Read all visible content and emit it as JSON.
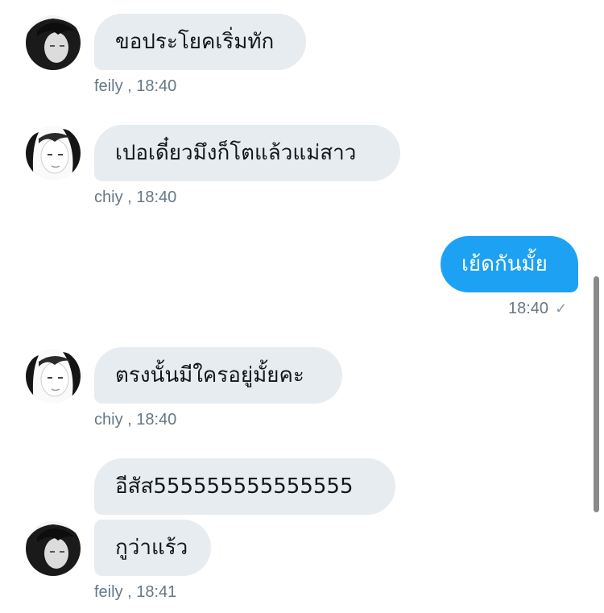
{
  "messages": [
    {
      "id": "m1",
      "direction": "in",
      "sender": "feily",
      "time": "18:40",
      "text": "ขอประโยคเริ่มทัก"
    },
    {
      "id": "m2",
      "direction": "in",
      "sender": "chiy",
      "time": "18:40",
      "text": "เปอเดี๋ยวมึงก็โตแล้วแม่สาว"
    },
    {
      "id": "m3",
      "direction": "out",
      "time": "18:40",
      "text": "เย้ดกันมั้ย",
      "status_icon": "sent-check-icon"
    },
    {
      "id": "m4",
      "direction": "in",
      "sender": "chiy",
      "time": "18:40",
      "text": "ตรงนั้นมีใครอยู่มั้ยคะ"
    },
    {
      "id": "m5",
      "direction": "in",
      "sender": "feily",
      "time": "18:41",
      "text": "อีสัส555555555555555"
    },
    {
      "id": "m6",
      "direction": "in",
      "sender": "feily",
      "time": "18:41",
      "text": "กูว่าแร้ว"
    }
  ],
  "meta_labels": {
    "m1": "feily  , 18:40",
    "m2": "chiy  , 18:40",
    "m3": "18:40",
    "m4": "chiy  , 18:40",
    "m6": "feily  , 18:41"
  },
  "icons": {
    "check": "✓"
  },
  "colors": {
    "incoming_bubble": "#e6ecf0",
    "outgoing_bubble": "#1da1f2",
    "meta_text": "#657786"
  }
}
